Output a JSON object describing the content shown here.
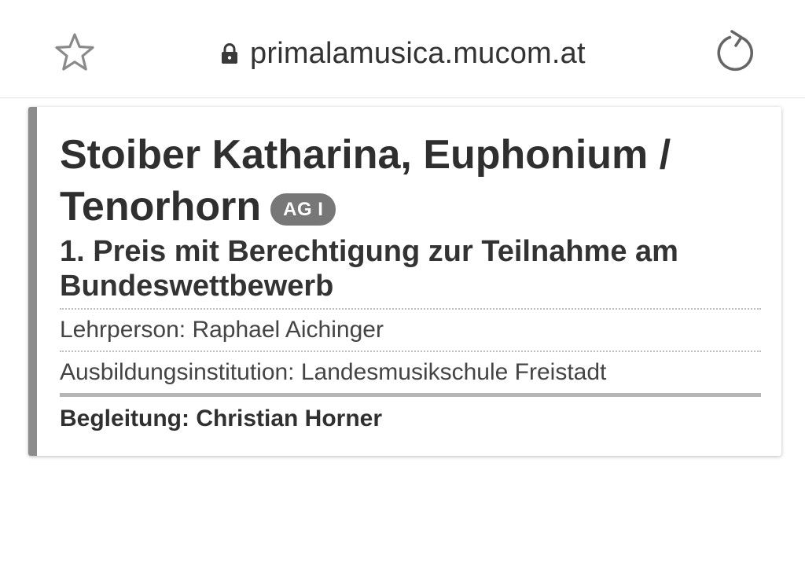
{
  "browser": {
    "url": "primalamusica.mucom.at",
    "icons": {
      "bookmark": "star-icon",
      "secure": "lock-icon",
      "reload": "reload-icon"
    }
  },
  "entry": {
    "name_instrument": "Stoiber Katharina, Euphonium / Tenorhorn",
    "age_group_badge": "AG I",
    "prize": "1. Preis mit Berechtigung zur Teilnahme am Bundeswettbewerb",
    "teacher": "Lehrperson: Raphael Aichinger",
    "institution": "Ausbildungsinstitution: Landesmusikschule Freistadt",
    "accompaniment": "Begleitung: Christian Horner"
  },
  "colors": {
    "card_accent": "#8c8c8c",
    "badge_bg": "#777777",
    "text": "#2e2e2e"
  }
}
